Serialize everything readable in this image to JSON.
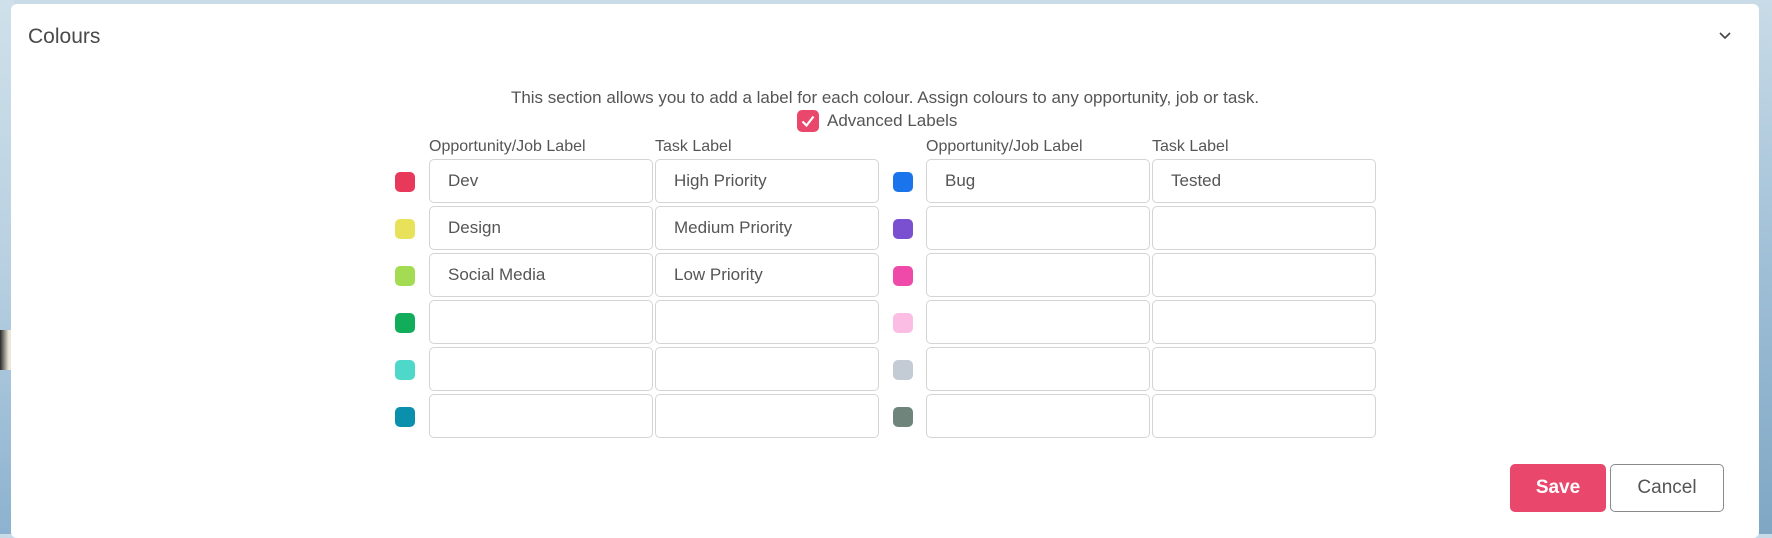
{
  "section": {
    "title": "Colours",
    "description": "This section allows you to add a label for each colour. Assign colours to any opportunity, job or task.",
    "advanced_labels": {
      "label": "Advanced Labels",
      "checked": true
    }
  },
  "columns": {
    "left_opportunity": "Opportunity/Job Label",
    "left_task": "Task Label",
    "right_opportunity": "Opportunity/Job Label",
    "right_task": "Task Label"
  },
  "left_rows": [
    {
      "color": "#e8395a",
      "opportunity": "Dev",
      "task": "High Priority"
    },
    {
      "color": "#e8e15a",
      "opportunity": "Design",
      "task": "Medium Priority"
    },
    {
      "color": "#a3dc52",
      "opportunity": "Social Media",
      "task": "Low Priority"
    },
    {
      "color": "#12ad5b",
      "opportunity": "",
      "task": ""
    },
    {
      "color": "#4dd8c9",
      "opportunity": "",
      "task": ""
    },
    {
      "color": "#0a8fad",
      "opportunity": "",
      "task": ""
    }
  ],
  "right_rows": [
    {
      "color": "#1a75ec",
      "opportunity": "Bug",
      "task": "Tested"
    },
    {
      "color": "#7a4fd0",
      "opportunity": "",
      "task": ""
    },
    {
      "color": "#ef4aa9",
      "opportunity": "",
      "task": ""
    },
    {
      "color": "#fbbde3",
      "opportunity": "",
      "task": ""
    },
    {
      "color": "#c3ccd4",
      "opportunity": "",
      "task": ""
    },
    {
      "color": "#6f857c",
      "opportunity": "",
      "task": ""
    }
  ],
  "actions": {
    "save": "Save",
    "cancel": "Cancel"
  }
}
